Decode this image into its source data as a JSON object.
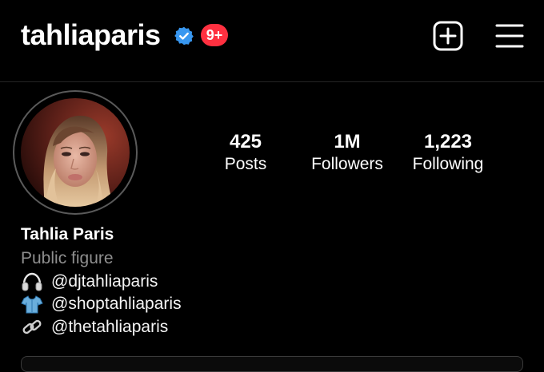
{
  "header": {
    "username": "tahliaparis",
    "verified_icon": "verified-badge-icon",
    "notification_badge": "9+",
    "new_post_icon": "plus-square-icon",
    "menu_icon": "hamburger-menu-icon"
  },
  "profile": {
    "avatar": "profile-photo",
    "stats": {
      "posts": {
        "value": "425",
        "label": "Posts"
      },
      "followers": {
        "value": "1M",
        "label": "Followers"
      },
      "following": {
        "value": "1,223",
        "label": "Following"
      }
    },
    "display_name": "Tahlia Paris",
    "category": "Public figure",
    "bio_links": [
      {
        "icon": "headphones-icon",
        "text": "@djtahliaparis"
      },
      {
        "icon": "shirt-icon",
        "text": "@shoptahliaparis"
      },
      {
        "icon": "link-icon",
        "text": "@thetahliaparis"
      }
    ]
  },
  "colors": {
    "background": "#000000",
    "text": "#ffffff",
    "secondary_text": "#8e8e8e",
    "badge": "#ff3040",
    "verified": "#3897f0"
  }
}
